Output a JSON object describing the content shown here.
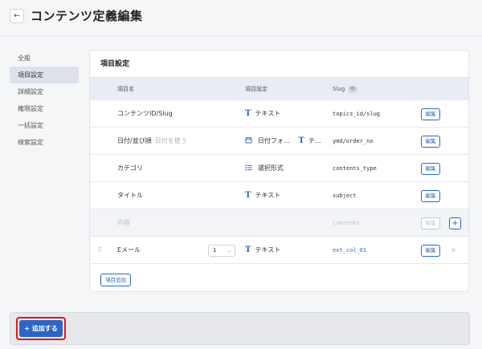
{
  "header": {
    "back_icon": "←",
    "title": "コンテンツ定義編集"
  },
  "sidebar": {
    "items": [
      {
        "label": "全般"
      },
      {
        "label": "項目設定"
      },
      {
        "label": "詳細設定"
      },
      {
        "label": "権限設定"
      },
      {
        "label": "一括設定"
      },
      {
        "label": "検索設定"
      }
    ],
    "active_index": 1
  },
  "card": {
    "title": "項目設定",
    "columns": {
      "name": "項目名",
      "setting": "項目設定",
      "slug": "Slug",
      "slug_badge": "ID"
    },
    "rows": [
      {
        "name": "コンテンツID/Slug",
        "type_icon": "T",
        "type": "テキスト",
        "slug": "topics_id/slug",
        "edit": "編集"
      },
      {
        "name": "日付/並び順",
        "sub": "日付を使う",
        "type_icon": "calendar-icon",
        "type": "日付フォ…",
        "type2_icon": "T",
        "type2": "テ…",
        "slug": "ymd/order_no",
        "edit": "編集"
      },
      {
        "name": "カテゴリ",
        "type_icon": "list-icon",
        "type": "選択形式",
        "slug": "contents_type",
        "edit": "編集"
      },
      {
        "name": "タイトル",
        "type_icon": "T",
        "type": "テキスト",
        "slug": "subject",
        "edit": "編集"
      },
      {
        "name": "内容",
        "slug": "contents",
        "edit": "編集",
        "plus": "+"
      },
      {
        "name": "Eメール",
        "select_value": "1",
        "type_icon": "T",
        "type": "テキスト",
        "slug": "ext_col_01",
        "edit": "編集",
        "remove": "×"
      }
    ],
    "add_item_label": "項目追加"
  },
  "footer": {
    "add_button_label": "+ 追加する"
  },
  "colors": {
    "accent": "#2a66c8",
    "highlight": "#e01818"
  }
}
